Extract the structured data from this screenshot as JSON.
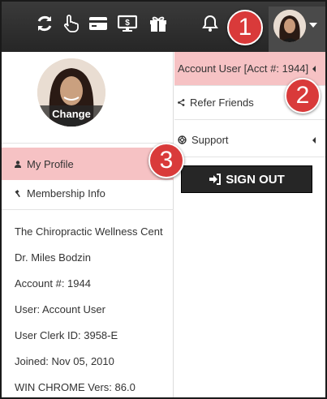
{
  "topbar": {
    "icons": [
      "refresh-icon",
      "hand-pointer-icon",
      "credit-card-icon",
      "monitor-dollar-icon",
      "gift-icon",
      "bell-icon"
    ]
  },
  "markers": [
    "1",
    "2",
    "3"
  ],
  "profile": {
    "change_label": "Change"
  },
  "left_menu": {
    "my_profile": "My Profile",
    "membership_info": "Membership Info"
  },
  "info": {
    "practice": "The Chiropractic Wellness Cent",
    "doctor": "Dr. Miles Bodzin",
    "account": "Account #: 1944",
    "user": "User: Account User",
    "clerk_id": "User Clerk ID: 3958-E",
    "joined": "Joined: Nov 05, 2010",
    "browser": "WIN CHROME Vers: 86.0"
  },
  "right_menu": {
    "account_user": "Account User [Acct #: 1944]",
    "refer_friends": "Refer Friends",
    "support": "Support",
    "sign_out": "SIGN OUT"
  },
  "colors": {
    "active_bg": "#f6c2c4",
    "marker": "#d93a3a",
    "topbar": "#2e2e2e"
  }
}
